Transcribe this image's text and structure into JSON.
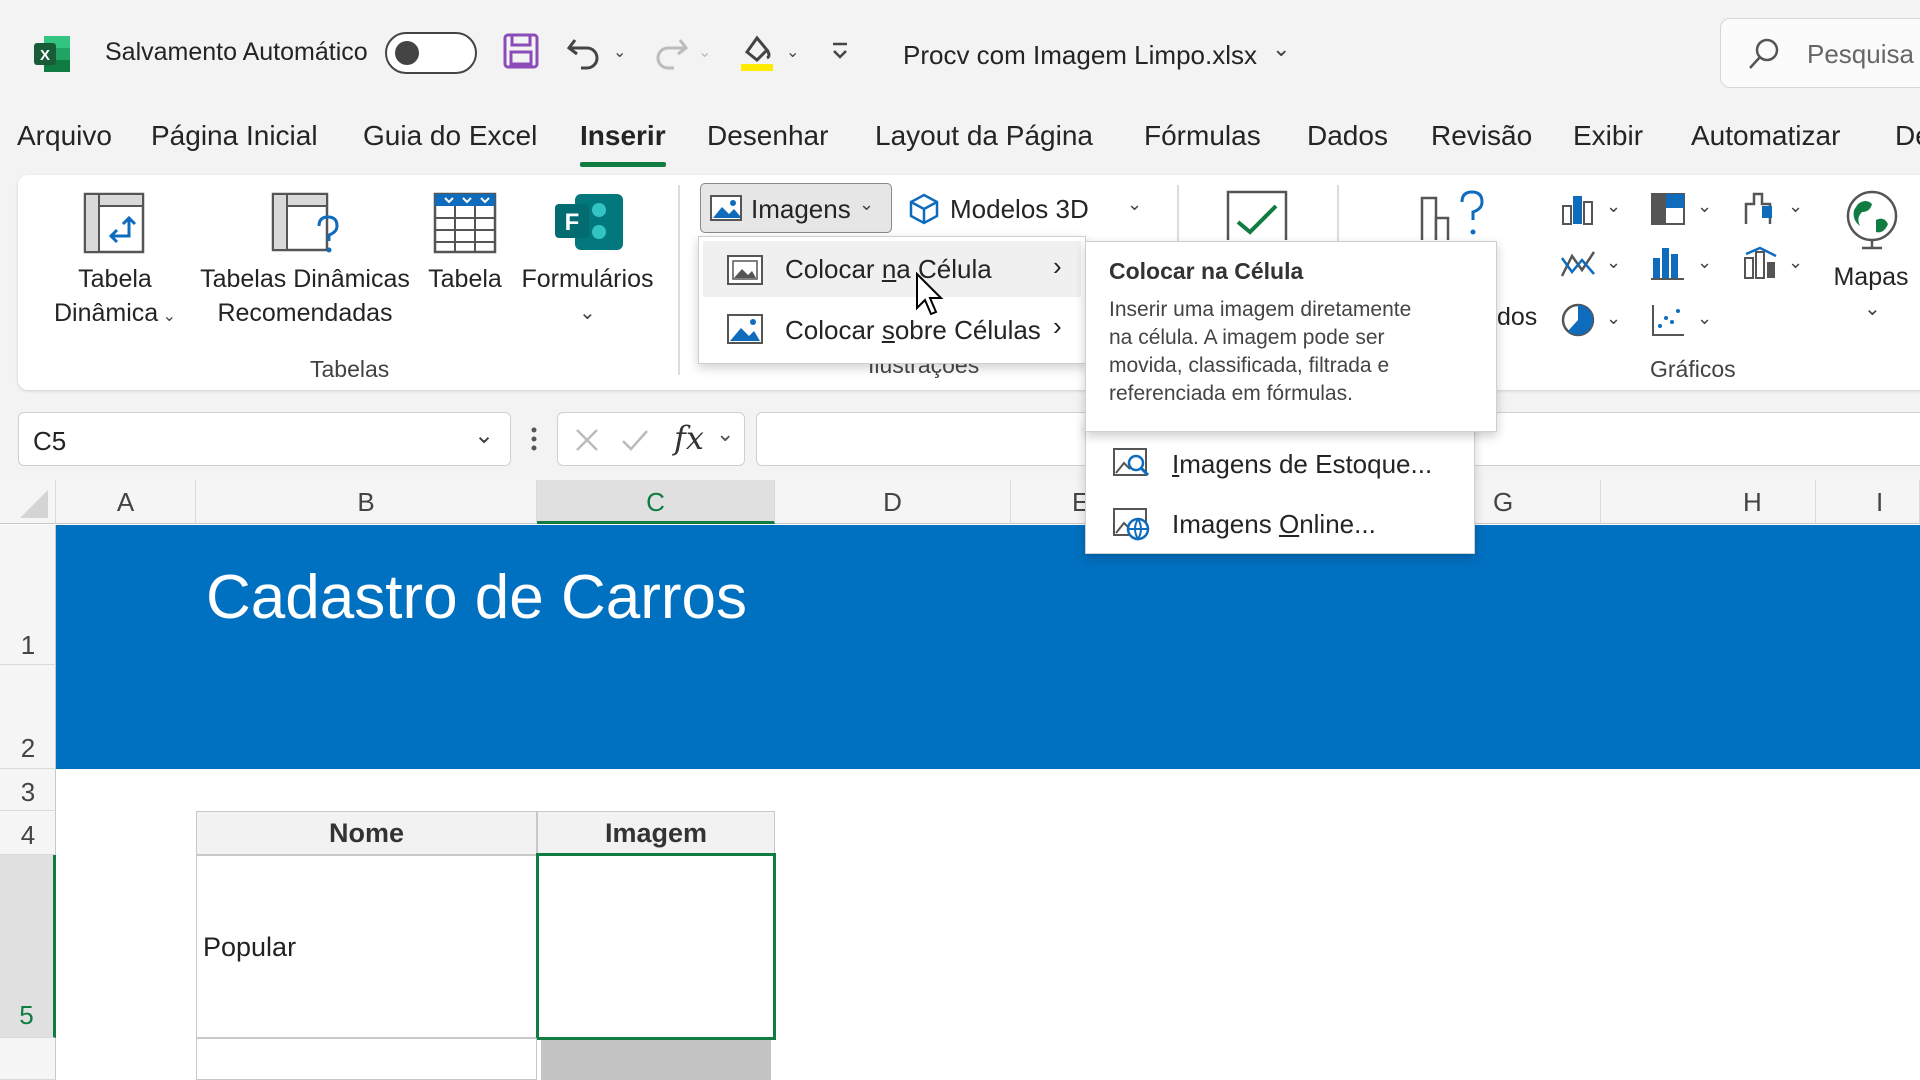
{
  "titlebar": {
    "autosave_label": "Salvamento Automático",
    "filename": "Procv com Imagem Limpo.xlsx",
    "search_placeholder": "Pesquisa"
  },
  "tabs": [
    "Arquivo",
    "Página Inicial",
    "Guia do Excel",
    "Inserir",
    "Desenhar",
    "Layout da Página",
    "Fórmulas",
    "Dados",
    "Revisão",
    "Exibir",
    "Automatizar",
    "De"
  ],
  "ribbon": {
    "pivot_line1": "Tabela",
    "pivot_line2": "Dinâmica",
    "rec_pivot_line1": "Tabelas Dinâmicas",
    "rec_pivot_line2": "Recomendadas",
    "table": "Tabela",
    "forms": "Formulários",
    "tables_group": "Tabelas",
    "images_button": "Imagens",
    "models3d": "Modelos 3D",
    "illustrations_group": "Ilustrações",
    "charts_partial": "dos",
    "maps": "Mapas",
    "charts_group": "Gráficos"
  },
  "images_menu": {
    "item1_pre": "Colocar ",
    "item1_u": "n",
    "item1_post": "a Célula",
    "item2_pre": "Colocar ",
    "item2_u": "s",
    "item2_post": "obre Células"
  },
  "tooltip": {
    "title": "Colocar na Célula",
    "line1": "Inserir uma imagem diretamente",
    "line2": "na célula. A imagem pode ser",
    "line3": "movida, classificada, filtrada e",
    "line4": "referenciada em fórmulas."
  },
  "submenu": {
    "stock_u": "I",
    "stock_rest": "magens de Estoque...",
    "online_pre": "Imagens ",
    "online_u": "O",
    "online_post": "nline..."
  },
  "formula_bar": {
    "name_box": "C5",
    "fx": "fx"
  },
  "grid": {
    "columns": [
      "A",
      "B",
      "C",
      "D",
      "E",
      "G",
      "H",
      "I"
    ],
    "rows": [
      "1",
      "2",
      "3",
      "4",
      "5"
    ],
    "banner_title": "Cadastro de Carros",
    "header_nome": "Nome",
    "header_imagem": "Imagem",
    "b5_value": "Popular"
  },
  "colors": {
    "accent_green": "#107c41",
    "banner_blue": "#0070c0",
    "excel_green": "#1d6f42"
  }
}
